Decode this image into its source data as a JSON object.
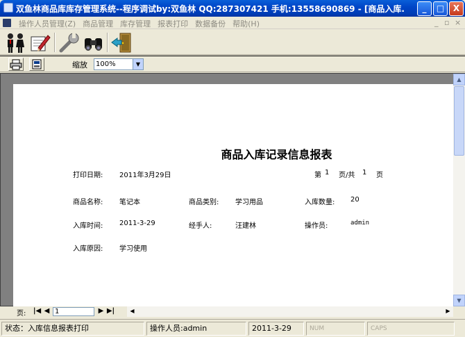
{
  "window": {
    "title": "双鱼林商品库库存管理系统--程序调试by:双鱼林 QQ:287307421 手机:13558690869 - [商品入库...",
    "minimize_glyph": "_",
    "maximize_glyph": "□",
    "close_glyph": "X"
  },
  "menu": {
    "items": [
      {
        "label": "操作人员管理(Z)"
      },
      {
        "label": "商品管理"
      },
      {
        "label": "库存管理"
      },
      {
        "label": "报表打印"
      },
      {
        "label": "数据备份"
      },
      {
        "label": "帮助(H)"
      }
    ],
    "mdi_min": "_",
    "mdi_restore": "▫",
    "mdi_close": "×"
  },
  "toolbar": {
    "icons": [
      "users-icon",
      "edit-form-icon",
      "wrench-icon",
      "binoculars-icon",
      "exit-door-icon"
    ]
  },
  "preview_toolbar": {
    "icons": [
      "print-icon",
      "export-icon"
    ],
    "zoom_label": "缩放",
    "zoom_value": "100%",
    "zoom_arrow": "▼"
  },
  "report": {
    "title": "商品入库记录信息报表",
    "print_date_label": "打印日期:",
    "print_date_value": "2011年3月29日",
    "page_prefix": "第",
    "page_current": "1",
    "page_mid": "页/共",
    "page_total": "1",
    "page_suffix": "页",
    "fields": {
      "name_label": "商品名称:",
      "name_value": "笔记本",
      "category_label": "商品类别:",
      "category_value": "学习用品",
      "qty_label": "入库数量:",
      "qty_value": "20",
      "time_label": "入库时间:",
      "time_value": "2011-3-29",
      "handler_label": "经手人:",
      "handler_value": "汪建林",
      "operator_label": "操作员:",
      "operator_value": "admin",
      "reason_label": "入库原因:",
      "reason_value": "学习使用"
    }
  },
  "navigation": {
    "page_label": "页:",
    "page_value": "1",
    "first_glyph": "|◀",
    "prev_glyph": "◀",
    "next_glyph": "▶",
    "last_glyph": "▶|",
    "up_glyph": "▲",
    "down_glyph": "▼",
    "left_glyph": "◀",
    "right_glyph": "▶"
  },
  "status": {
    "state": "状态：入库信息报表打印",
    "operator": "操作人员:admin",
    "date": "2011-3-29",
    "num": "NUM",
    "caps": "CAPS"
  }
}
